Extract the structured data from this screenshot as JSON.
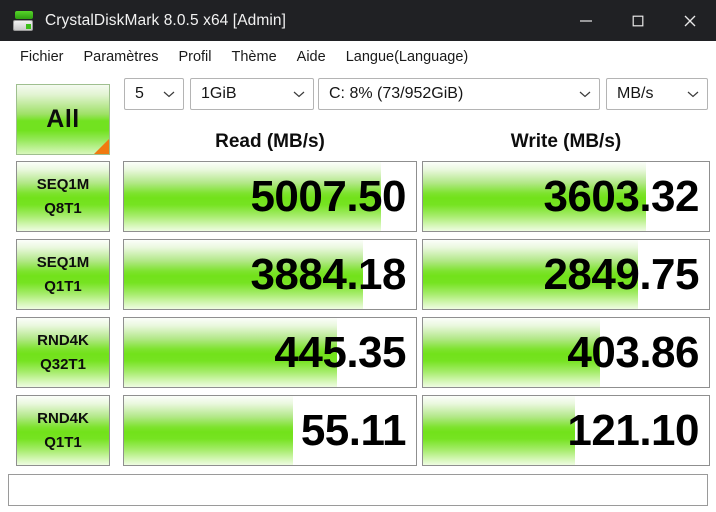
{
  "window": {
    "title": "CrystalDiskMark 8.0.5 x64 [Admin]",
    "icon": "disk-drive-icon",
    "controls": {
      "minimize": "minimize-icon",
      "maximize": "maximize-icon",
      "close": "close-icon"
    }
  },
  "menu": {
    "items": [
      {
        "label": "Fichier"
      },
      {
        "label": "Paramètres"
      },
      {
        "label": "Profil"
      },
      {
        "label": "Thème"
      },
      {
        "label": "Aide"
      },
      {
        "label": "Langue(Language)"
      }
    ]
  },
  "toolbar": {
    "all_button": "All",
    "test_count": "5",
    "test_size": "1GiB",
    "drive": "C: 8% (73/952GiB)",
    "unit": "MB/s"
  },
  "headers": {
    "read": "Read (MB/s)",
    "write": "Write (MB/s)"
  },
  "results": {
    "rows": [
      {
        "label_line1": "SEQ1M",
        "label_line2": "Q8T1",
        "read": "5007.50",
        "write": "3603.32",
        "read_fill": "88%",
        "write_fill": "78%"
      },
      {
        "label_line1": "SEQ1M",
        "label_line2": "Q1T1",
        "read": "3884.18",
        "write": "2849.75",
        "read_fill": "82%",
        "write_fill": "75%"
      },
      {
        "label_line1": "RND4K",
        "label_line2": "Q32T1",
        "read": "445.35",
        "write": "403.86",
        "read_fill": "73%",
        "write_fill": "62%"
      },
      {
        "label_line1": "RND4K",
        "label_line2": "Q1T1",
        "read": "55.11",
        "write": "121.10",
        "read_fill": "58%",
        "write_fill": "53%"
      }
    ]
  },
  "status_box": {
    "value": "",
    "placeholder": ""
  },
  "colors": {
    "titlebar_bg": "#202124",
    "bar_green": "#72e21a",
    "accent_orange": "#f07a10",
    "border_gray": "#8f8f8f"
  }
}
